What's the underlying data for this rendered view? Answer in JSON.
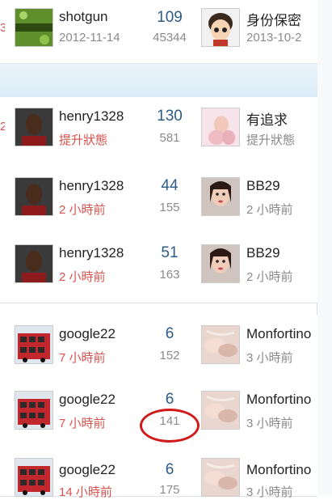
{
  "rows": [
    {
      "edge_char": "3",
      "author": {
        "avatar": "game-logo-avatar",
        "name": "shotgun",
        "sub": "2012-11-14",
        "sub_color": "gray"
      },
      "replies": "109",
      "views": "45344",
      "last": {
        "avatar": "cartoon-avatar",
        "name": "身份保密",
        "sub": "2013-10-2",
        "sub_color": "gray"
      }
    },
    {
      "edge_char": "2",
      "author": {
        "avatar": "man-portrait-avatar",
        "name": "henry1328",
        "sub": "提升狀態",
        "sub_color": "red"
      },
      "replies": "130",
      "views": "581",
      "last": {
        "avatar": "woman-pink-avatar",
        "name": "有追求",
        "sub": "提升狀態",
        "sub_color": "gray"
      }
    },
    {
      "edge_char": "",
      "author": {
        "avatar": "man-portrait-avatar",
        "name": "henry1328",
        "sub": "2 小時前",
        "sub_color": "red"
      },
      "replies": "44",
      "views": "155",
      "last": {
        "avatar": "woman-portrait-avatar",
        "name": "BB29",
        "sub": "2 小時前",
        "sub_color": "gray"
      }
    },
    {
      "edge_char": "",
      "author": {
        "avatar": "man-portrait-avatar",
        "name": "henry1328",
        "sub": "2 小時前",
        "sub_color": "red"
      },
      "replies": "51",
      "views": "163",
      "last": {
        "avatar": "woman-portrait-avatar",
        "name": "BB29",
        "sub": "2 小時前",
        "sub_color": "gray"
      }
    },
    {
      "edge_char": "",
      "author": {
        "avatar": "red-bus-avatar",
        "name": "google22",
        "sub": "7 小時前",
        "sub_color": "red"
      },
      "replies": "6",
      "views": "152",
      "last": {
        "avatar": "pink-photo-avatar",
        "name": "Monfortino",
        "sub": "3 小時前",
        "sub_color": "gray"
      }
    },
    {
      "edge_char": "",
      "author": {
        "avatar": "red-bus-avatar",
        "name": "google22",
        "sub": "7 小時前",
        "sub_color": "red"
      },
      "replies": "6",
      "views": "141",
      "last": {
        "avatar": "pink-photo-avatar",
        "name": "Monfortino",
        "sub": "3 小時前",
        "sub_color": "gray"
      }
    },
    {
      "edge_char": "",
      "author": {
        "avatar": "red-bus-avatar",
        "name": "google22",
        "sub": "14 小時前",
        "sub_color": "red"
      },
      "replies": "6",
      "views": "175",
      "last": {
        "avatar": "pink-photo-avatar",
        "name": "Monfortino",
        "sub": "3 小時前",
        "sub_color": "gray"
      }
    }
  ],
  "highlight": {
    "shape": "red-ellipse",
    "target": "views of row 6",
    "color": "#d11a1a"
  },
  "colors": {
    "reply_count": "#2c5b86",
    "red_text": "#d9534f",
    "gray_text": "#8a8a8a"
  }
}
